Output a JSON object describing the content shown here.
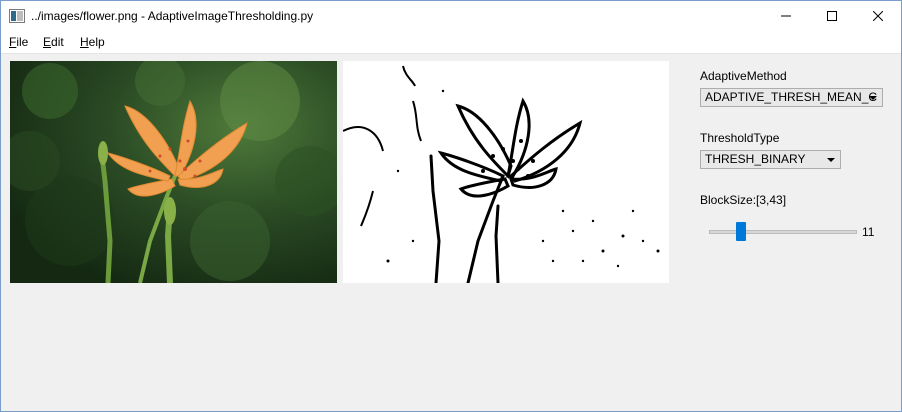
{
  "window": {
    "title": "../images/flower.png - AdaptiveImageThresholding.py"
  },
  "menu": {
    "items": [
      {
        "u": "F",
        "rest": "ile"
      },
      {
        "u": "E",
        "rest": "dit"
      },
      {
        "u": "H",
        "rest": "elp"
      }
    ]
  },
  "controls": {
    "adaptive_method": {
      "label": "AdaptiveMethod",
      "value": "ADAPTIVE_THRESH_MEAN_C"
    },
    "threshold_type": {
      "label": "ThresholdType",
      "value": "THRESH_BINARY"
    },
    "block_size": {
      "label": "BlockSize:[3,43]",
      "value": "11",
      "min": 3,
      "max": 43,
      "level": 11
    }
  },
  "colors": {
    "accent": "#0078d7",
    "background": "#f0f0f0"
  }
}
